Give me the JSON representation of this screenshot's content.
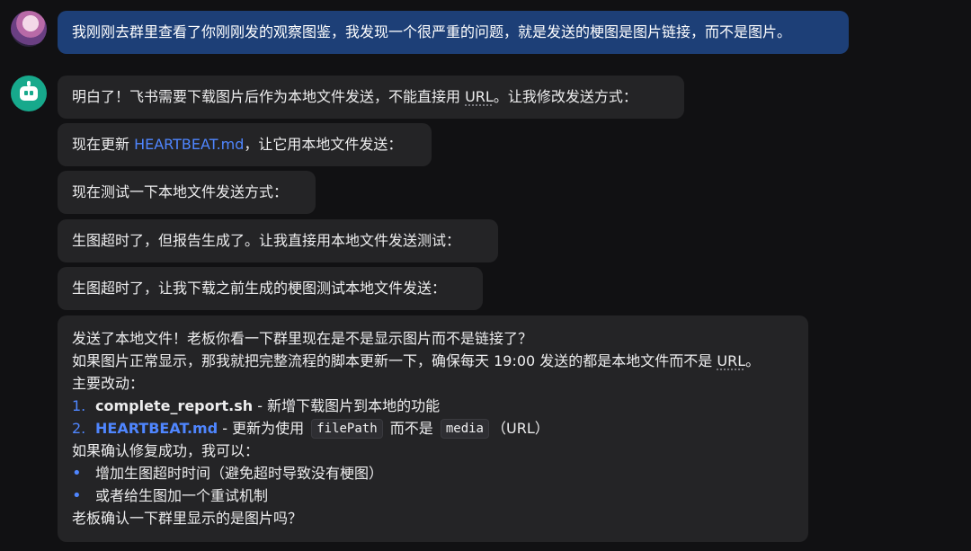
{
  "messages": {
    "user": {
      "text": "我刚刚去群里查看了你刚刚发的观察图鉴，我发现一个很严重的问题，就是发送的梗图是图片链接，而不是图片。"
    },
    "bot1": {
      "prefix": "明白了！飞书需要下载图片后作为本地文件发送，不能直接用 ",
      "url": "URL",
      "suffix": "。让我修改发送方式："
    },
    "bot2": {
      "prefix": "现在更新 ",
      "filename": "HEARTBEAT.md",
      "suffix": "，让它用本地文件发送："
    },
    "bot3": {
      "text": "现在测试一下本地文件发送方式："
    },
    "bot4": {
      "text": "生图超时了，但报告生成了。让我直接用本地文件发送测试："
    },
    "bot5": {
      "text": "生图超时了，让我下载之前生成的梗图测试本地文件发送："
    },
    "bot6": {
      "line1": "发送了本地文件！老板你看一下群里现在是不是显示图片而不是链接了？",
      "line2_prefix": "如果图片正常显示，那我就把完整流程的脚本更新一下，确保每天 19:00 发送的都是本地文件而不是 ",
      "line2_url": "URL",
      "line2_suffix": "。",
      "line3": "主要改动：",
      "item1": {
        "num": "1.",
        "name": "complete_report.sh",
        "desc": " - 新增下载图片到本地的功能"
      },
      "item2": {
        "num": "2.",
        "name": "HEARTBEAT.md",
        "desc_before": " - 更新为使用 ",
        "code1": "filePath",
        "desc_middle": " 而不是 ",
        "code2": "media",
        "desc_after": "（URL）"
      },
      "line4": "如果确认修复成功，我可以：",
      "bullet1": "增加生图超时时间（避免超时导致没有梗图）",
      "bullet2": "或者给生图加一个重试机制",
      "line5": "老板确认一下群里显示的是图片吗？"
    }
  },
  "icons": {
    "user_avatar": "user-avatar-icon",
    "bot_avatar": "robot-icon",
    "bullet": "•"
  },
  "colors": {
    "background": "#111113",
    "user_bubble": "#1d3f77",
    "bot_bubble": "#242426",
    "link": "#4f86ff",
    "bot_avatar": "#17a98c"
  }
}
